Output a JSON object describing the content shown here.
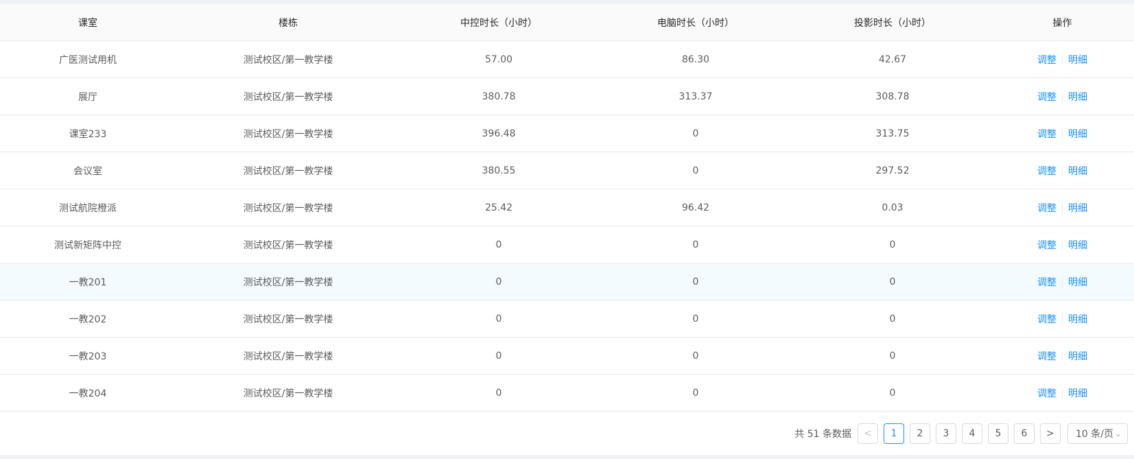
{
  "table": {
    "columns": [
      "课室",
      "楼栋",
      "中控时长（小时）",
      "电脑时长（小时）",
      "投影时长（小时）",
      "操作"
    ],
    "rows": [
      {
        "room": "广医测试用机",
        "building": "测试校区/第一教学楼",
        "control": "57.00",
        "pc": "86.30",
        "projector": "42.67"
      },
      {
        "room": "展厅",
        "building": "测试校区/第一教学楼",
        "control": "380.78",
        "pc": "313.37",
        "projector": "308.78"
      },
      {
        "room": "课室233",
        "building": "测试校区/第一教学楼",
        "control": "396.48",
        "pc": "0",
        "projector": "313.75"
      },
      {
        "room": "会议室",
        "building": "测试校区/第一教学楼",
        "control": "380.55",
        "pc": "0",
        "projector": "297.52"
      },
      {
        "room": "测试航院橙派",
        "building": "测试校区/第一教学楼",
        "control": "25.42",
        "pc": "96.42",
        "projector": "0.03"
      },
      {
        "room": "测试新矩阵中控",
        "building": "测试校区/第一教学楼",
        "control": "0",
        "pc": "0",
        "projector": "0"
      },
      {
        "room": "一教201",
        "building": "测试校区/第一教学楼",
        "control": "0",
        "pc": "0",
        "projector": "0"
      },
      {
        "room": "一教202",
        "building": "测试校区/第一教学楼",
        "control": "0",
        "pc": "0",
        "projector": "0"
      },
      {
        "room": "一教203",
        "building": "测试校区/第一教学楼",
        "control": "0",
        "pc": "0",
        "projector": "0"
      },
      {
        "room": "一教204",
        "building": "测试校区/第一教学楼",
        "control": "0",
        "pc": "0",
        "projector": "0"
      }
    ],
    "actions": {
      "adjust": "调整",
      "detail": "明细"
    },
    "highlighted_row": 6
  },
  "pagination": {
    "total_text": "共 51 条数据",
    "prev": "<",
    "next": ">",
    "pages": [
      "1",
      "2",
      "3",
      "4",
      "5",
      "6"
    ],
    "current": "1",
    "page_size": "10 条/页"
  },
  "colors": {
    "link": "#1890ff",
    "header_bg": "#fafafa",
    "highlight_bg": "#f4fbff",
    "border": "#e8e8e8"
  },
  "icons": {
    "size_select": "chevron-down-icon",
    "prev": "chevron-left-icon",
    "next": "chevron-right-icon"
  }
}
